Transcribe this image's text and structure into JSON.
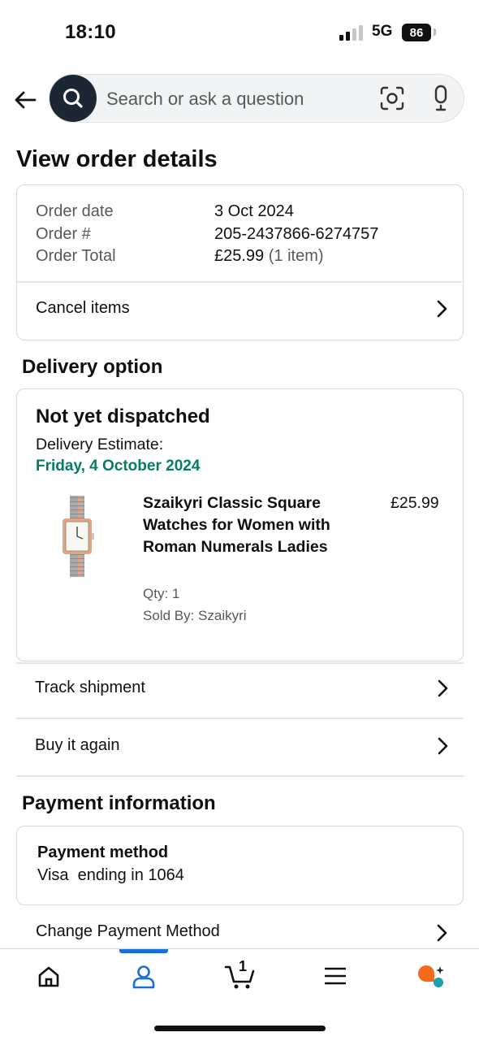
{
  "status_bar": {
    "time": "18:10",
    "network": "5G",
    "battery": "86"
  },
  "search": {
    "placeholder": "Search or ask a question"
  },
  "page_title": "View order details",
  "order_summary": {
    "rows": [
      {
        "label": "Order date",
        "value": "3 Oct 2024"
      },
      {
        "label": "Order #",
        "value": "205-2437866-6274757"
      },
      {
        "label": "Order Total",
        "value": "£25.99",
        "suffix": "(1 item)"
      }
    ],
    "cancel_label": "Cancel items"
  },
  "delivery": {
    "heading": "Delivery option",
    "status": "Not yet dispatched",
    "estimate_label": "Delivery Estimate:",
    "estimate_date": "Friday, 4 October 2024",
    "product": {
      "title": "Szaikyri Classic Square Watches for Women with Roman Numerals Ladies",
      "price": "£25.99",
      "qty": "Qty: 1",
      "sold_by": "Sold By: Szaikyri"
    },
    "track_label": "Track shipment",
    "buy_again_label": "Buy it again"
  },
  "payment": {
    "heading": "Payment information",
    "method_label": "Payment method",
    "method_value": "Visa  ending in 1064",
    "change_label": "Change Payment Method"
  },
  "bottom_nav": {
    "cart_count": "1",
    "items": [
      "home-icon",
      "account-icon",
      "cart-icon",
      "menu-icon",
      "rufus-icon"
    ],
    "active": "account-icon",
    "accent": "#1b6fd8"
  },
  "colors": {
    "delivery_date": "#067d62",
    "search_button": "#1b2733"
  }
}
